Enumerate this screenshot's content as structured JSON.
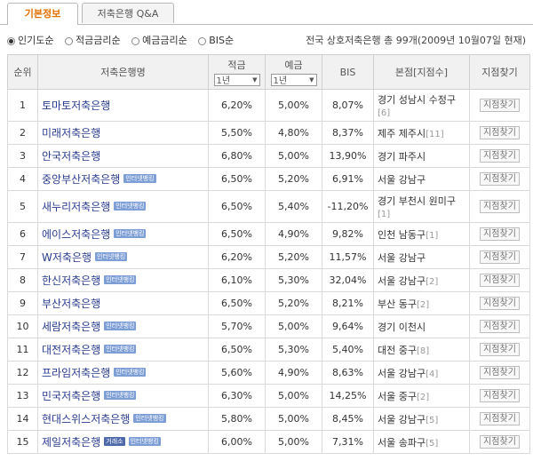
{
  "tabs": [
    {
      "label": "기본정보",
      "active": true
    },
    {
      "label": "저축은행 Q&A",
      "active": false
    }
  ],
  "filter": {
    "options": [
      {
        "label": "인기도순",
        "selected": true
      },
      {
        "label": "적금금리순",
        "selected": false
      },
      {
        "label": "예금금리순",
        "selected": false
      },
      {
        "label": "BIS순",
        "selected": false
      }
    ],
    "summary": "전국 상호저축은행 총 99개(2009년 10월07일 현재)"
  },
  "table": {
    "headers": {
      "rank": "순위",
      "name": "저축은행명",
      "savings": "적금",
      "deposit": "예금",
      "bis": "BIS",
      "hq": "본점[지점수]",
      "find": "지점찾기"
    },
    "savings_select": "1년",
    "deposit_select": "1년",
    "find_label": "지점찾기",
    "rows": [
      {
        "rank": "1",
        "name": "토마토저축은행",
        "badges": [],
        "savings": "6,20%",
        "deposit": "5,00%",
        "bis": "8,07%",
        "hq": "경기 성남시 수정구",
        "branches": "[6]"
      },
      {
        "rank": "2",
        "name": "미래저축은행",
        "badges": [],
        "savings": "5,50%",
        "deposit": "4,80%",
        "bis": "8,37%",
        "hq": "제주 제주시",
        "branches": "[11]"
      },
      {
        "rank": "3",
        "name": "안국저축은행",
        "badges": [],
        "savings": "6,80%",
        "deposit": "5,00%",
        "bis": "13,90%",
        "hq": "경기 파주시",
        "branches": ""
      },
      {
        "rank": "4",
        "name": "중앙부산저축은행",
        "badges": [
          "인터넷뱅킹"
        ],
        "savings": "6,50%",
        "deposit": "5,20%",
        "bis": "6,91%",
        "hq": "서울 강남구",
        "branches": ""
      },
      {
        "rank": "5",
        "name": "새누리저축은행",
        "badges": [
          "인터넷뱅킹"
        ],
        "savings": "6,50%",
        "deposit": "5,40%",
        "bis": "-11,20%",
        "hq": "경기 부천시 원미구",
        "branches": "[1]"
      },
      {
        "rank": "6",
        "name": "에이스저축은행",
        "badges": [
          "인터넷뱅킹"
        ],
        "savings": "6,50%",
        "deposit": "4,90%",
        "bis": "9,82%",
        "hq": "인천 남동구",
        "branches": "[1]"
      },
      {
        "rank": "7",
        "name": "W저축은행",
        "badges": [
          "인터넷뱅킹"
        ],
        "savings": "6,20%",
        "deposit": "5,20%",
        "bis": "11,57%",
        "hq": "서울 강남구",
        "branches": ""
      },
      {
        "rank": "8",
        "name": "한신저축은행",
        "badges": [
          "인터넷뱅킹"
        ],
        "savings": "6,10%",
        "deposit": "5,30%",
        "bis": "32,04%",
        "hq": "서울 강남구",
        "branches": "[2]"
      },
      {
        "rank": "9",
        "name": "부산저축은행",
        "badges": [],
        "savings": "6,50%",
        "deposit": "5,20%",
        "bis": "8,21%",
        "hq": "부산 동구",
        "branches": "[2]"
      },
      {
        "rank": "10",
        "name": "세람저축은행",
        "badges": [
          "인터넷뱅킹"
        ],
        "savings": "5,70%",
        "deposit": "5,00%",
        "bis": "9,64%",
        "hq": "경기 이천시",
        "branches": ""
      },
      {
        "rank": "11",
        "name": "대전저축은행",
        "badges": [
          "인터넷뱅킹"
        ],
        "savings": "6,50%",
        "deposit": "5,30%",
        "bis": "5,40%",
        "hq": "대전 중구",
        "branches": "[8]"
      },
      {
        "rank": "12",
        "name": "프라임저축은행",
        "badges": [
          "인터넷뱅킹"
        ],
        "savings": "5,60%",
        "deposit": "4,90%",
        "bis": "8,63%",
        "hq": "서울 강남구",
        "branches": "[4]"
      },
      {
        "rank": "13",
        "name": "민국저축은행",
        "badges": [
          "인터넷뱅킹"
        ],
        "savings": "6,30%",
        "deposit": "5,00%",
        "bis": "14,25%",
        "hq": "서울 중구",
        "branches": "[2]"
      },
      {
        "rank": "14",
        "name": "현대스위스저축은행",
        "badges": [
          "인터넷뱅킹"
        ],
        "savings": "5,80%",
        "deposit": "5,00%",
        "bis": "8,45%",
        "hq": "서울 강남구",
        "branches": "[5]"
      },
      {
        "rank": "15",
        "name": "제일저축은행",
        "badges": [
          "거래소",
          "인터넷뱅킹"
        ],
        "savings": "6,00%",
        "deposit": "5,00%",
        "bis": "7,31%",
        "hq": "서울 송파구",
        "branches": "[5]"
      }
    ]
  }
}
